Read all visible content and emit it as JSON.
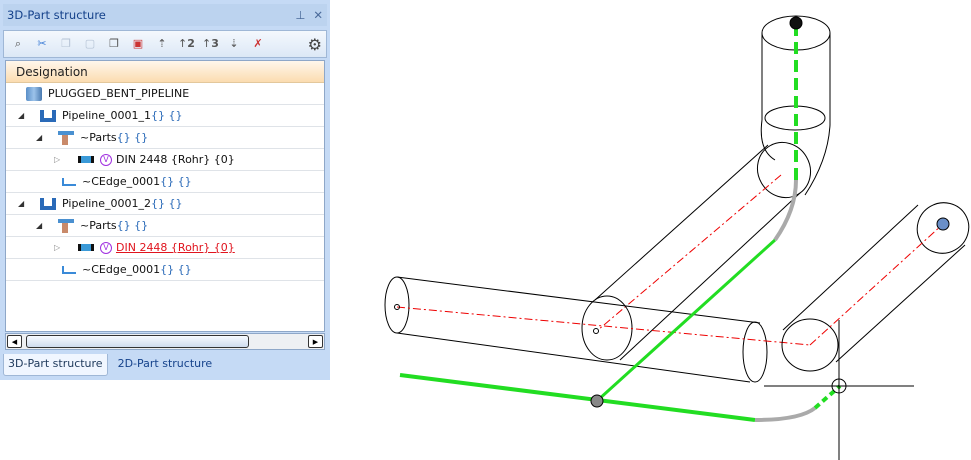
{
  "panel": {
    "title": "3D-Part structure",
    "pin_icon": "pin-icon",
    "close_icon": "close-icon"
  },
  "toolbar": {
    "icons": [
      "find-icon",
      "cut-icon",
      "copy-icon",
      "paste-icon",
      "copy-attributes-icon",
      "paste-attributes-icon",
      "collapse-level-1-icon",
      "expand-level-2-icon",
      "expand-level-3-icon",
      "expand-all-icon",
      "clear-sort-icon",
      "settings-icon"
    ],
    "level2": "2",
    "level3": "3"
  },
  "tree": {
    "header": "Designation",
    "rows": [
      {
        "label": "PLUGGED_BENT_PIPELINE",
        "suffix": ""
      },
      {
        "label": "Pipeline_0001_1",
        "suffix": " {} {}"
      },
      {
        "label": "~Parts",
        "suffix": " {} {}"
      },
      {
        "label": "DIN 2448 {Rohr} {0}",
        "suffix": "",
        "badge": "V"
      },
      {
        "label": "~CEdge_0001",
        "suffix": " {} {}"
      },
      {
        "label": "Pipeline_0001_2",
        "suffix": " {} {}"
      },
      {
        "label": "~Parts",
        "suffix": " {} {}"
      },
      {
        "label": "DIN 2448 {Rohr} {0}",
        "suffix": "",
        "badge": "V",
        "state": "error"
      },
      {
        "label": "~CEdge_0001",
        "suffix": " {} {}"
      }
    ]
  },
  "tabs": [
    "3D-Part structure",
    "2D-Part structure"
  ],
  "colors": {
    "accent": "#c5daf5",
    "path": "#22dd22",
    "error": "#e0141e"
  }
}
